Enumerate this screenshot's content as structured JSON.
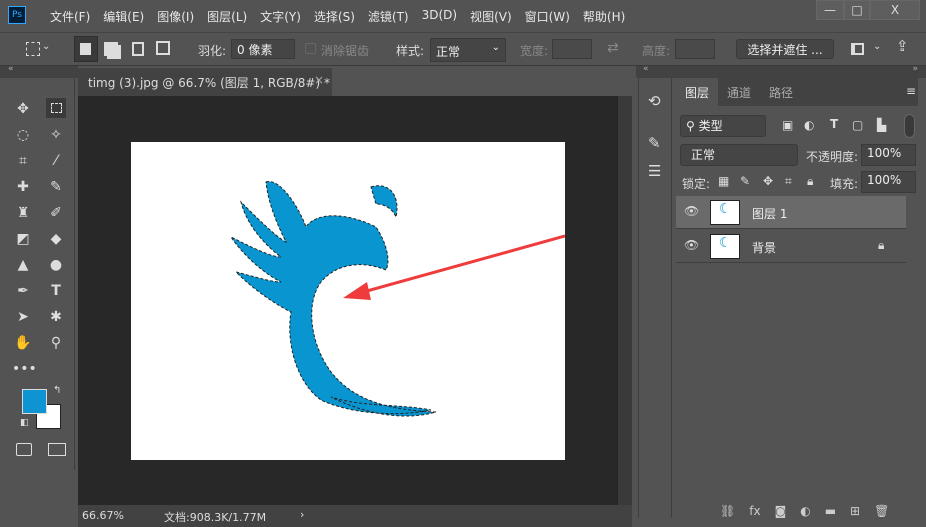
{
  "app": {
    "logo": "Ps",
    "menu": [
      "文件(F)",
      "编辑(E)",
      "图像(I)",
      "图层(L)",
      "文字(Y)",
      "选择(S)",
      "滤镜(T)",
      "3D(D)",
      "视图(V)",
      "窗口(W)",
      "帮助(H)"
    ],
    "window_buttons": [
      "—",
      "□",
      "X"
    ]
  },
  "options": {
    "feather_label": "羽化:",
    "feather_value": "0 像素",
    "antialias_label": "消除锯齿",
    "style_label": "样式:",
    "style_value": "正常",
    "width_label": "宽度:",
    "height_label": "高度:",
    "select_mask_button": "选择并遮住 ..."
  },
  "document": {
    "tab_title": "timg (3).jpg @ 66.7% (图层 1, RGB/8#) *",
    "close": "×"
  },
  "status": {
    "zoom": "66.67%",
    "doc_info": "文档:908.3K/1.77M",
    "arrow": "›"
  },
  "colors": {
    "foreground": "#0e93d3",
    "background": "#ffffff",
    "logo_blue": "#0995cf",
    "arrow_red": "#ef3b3b"
  },
  "layers_panel": {
    "tabs": [
      "图层",
      "通道",
      "路径"
    ],
    "filter_label": "类型",
    "blend_mode": "正常",
    "opacity_label": "不透明度:",
    "opacity_value": "100%",
    "lock_label": "锁定:",
    "fill_label": "填充:",
    "fill_value": "100%",
    "layers": [
      {
        "name": "图层 1",
        "selected": true,
        "visible": true
      },
      {
        "name": "背景",
        "selected": false,
        "visible": true,
        "locked": true
      }
    ]
  }
}
